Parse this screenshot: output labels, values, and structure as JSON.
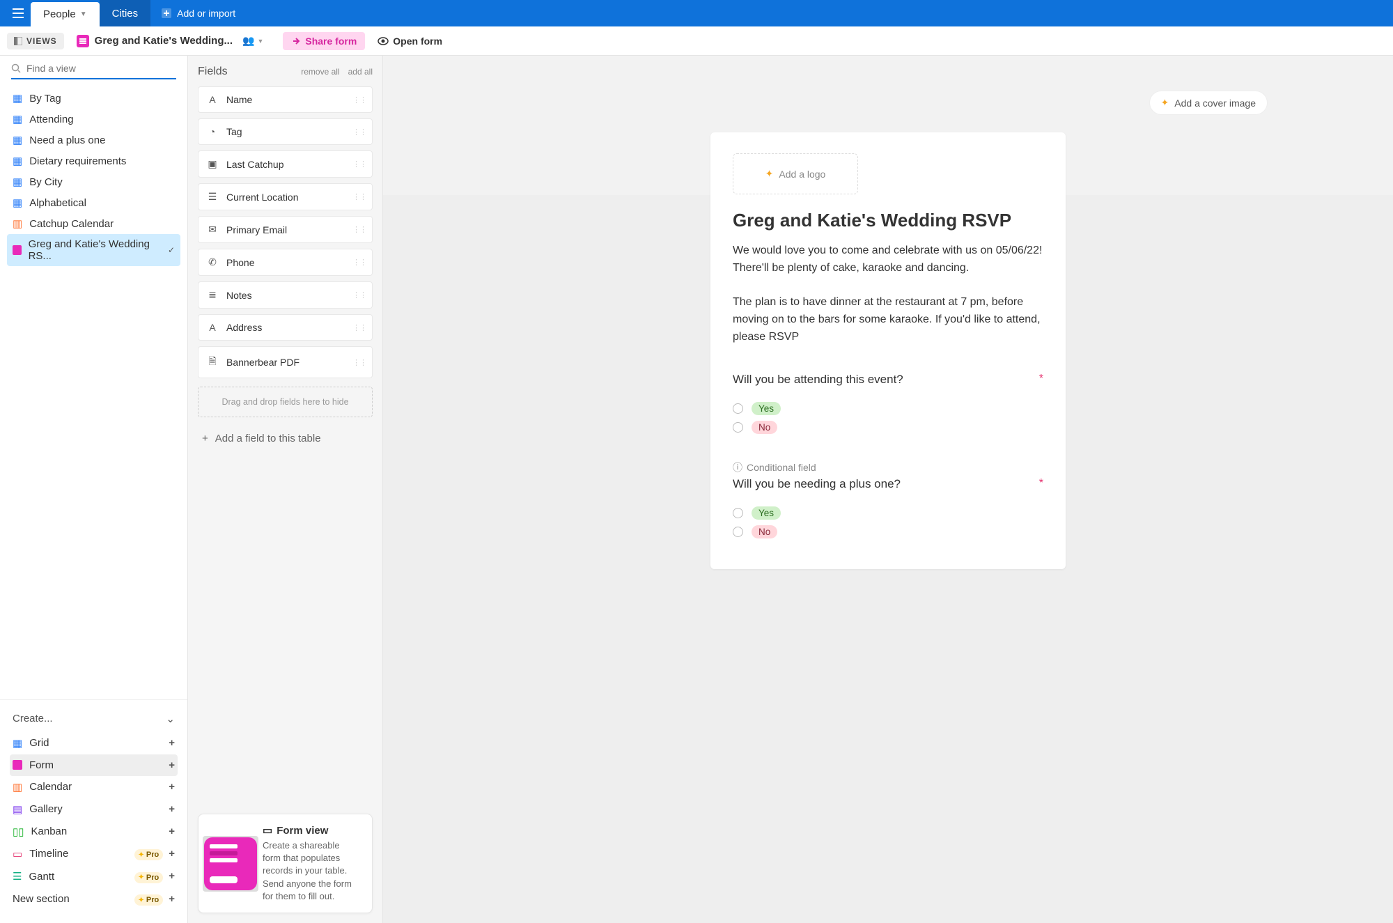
{
  "topbar": {
    "people_label": "People",
    "cities_label": "Cities",
    "add_import_label": "Add or import"
  },
  "toolbar": {
    "views_label": "VIEWS",
    "form_title": "Greg and Katie's Wedding...",
    "share_form_label": "Share form",
    "open_form_label": "Open form"
  },
  "view_search": {
    "placeholder": "Find a view"
  },
  "views": [
    {
      "label": "By Tag",
      "icon": "grid"
    },
    {
      "label": "Attending",
      "icon": "grid"
    },
    {
      "label": "Need a plus one",
      "icon": "grid"
    },
    {
      "label": "Dietary requirements",
      "icon": "grid"
    },
    {
      "label": "By City",
      "icon": "grid"
    },
    {
      "label": "Alphabetical",
      "icon": "grid"
    },
    {
      "label": "Catchup Calendar",
      "icon": "calendar"
    },
    {
      "label": "Greg and Katie's Wedding RS...",
      "icon": "form",
      "active": true,
      "check": true
    }
  ],
  "create": {
    "head": "Create...",
    "items": [
      {
        "label": "Grid",
        "icon": "grid",
        "color": "#2d7ff9"
      },
      {
        "label": "Form",
        "icon": "form",
        "color": "#e929ba",
        "active": true
      },
      {
        "label": "Calendar",
        "icon": "calendar",
        "color": "#ff6f2c"
      },
      {
        "label": "Gallery",
        "icon": "gallery",
        "color": "#7c39ed"
      },
      {
        "label": "Kanban",
        "icon": "kanban",
        "color": "#11af22"
      },
      {
        "label": "Timeline",
        "icon": "timeline",
        "color": "#e5326f",
        "pro": true
      },
      {
        "label": "Gantt",
        "icon": "gantt",
        "color": "#11af82",
        "pro": true
      },
      {
        "label": "New section",
        "icon": "",
        "pro": true
      }
    ],
    "pro_label": "Pro"
  },
  "fields_panel": {
    "title": "Fields",
    "remove_all": "remove all",
    "add_all": "add all",
    "drop_hint": "Drag and drop fields here to hide",
    "add_field": "Add a field to this table",
    "items": [
      {
        "label": "Name",
        "icon": "A"
      },
      {
        "label": "Tag",
        "icon": "tag"
      },
      {
        "label": "Last Catchup",
        "icon": "date"
      },
      {
        "label": "Current Location",
        "icon": "list"
      },
      {
        "label": "Primary Email",
        "icon": "mail"
      },
      {
        "label": "Phone",
        "icon": "phone"
      },
      {
        "label": "Notes",
        "icon": "notes"
      },
      {
        "label": "Address",
        "icon": "A"
      },
      {
        "label": "Bannerbear PDF",
        "icon": "file"
      }
    ]
  },
  "info_card": {
    "title": "Form view",
    "body": "Create a shareable form that populates records in your table. Send anyone the form for them to fill out."
  },
  "form_preview": {
    "add_cover": "Add a cover image",
    "add_logo": "Add a logo",
    "heading": "Greg and Katie's Wedding RSVP",
    "body": "We would love you to come and celebrate with us on 05/06/22! There'll be plenty of cake, karaoke and dancing.\n\nThe plan is to have dinner at the restaurant at 7 pm, before moving on to the bars for some karaoke. If you'd like to attend, please RSVP",
    "q1": {
      "label": "Will you be attending this event?",
      "opt_yes": "Yes",
      "opt_no": "No"
    },
    "q2": {
      "cond": "Conditional field",
      "label": "Will you be needing a plus one?",
      "opt_yes": "Yes",
      "opt_no": "No"
    }
  }
}
